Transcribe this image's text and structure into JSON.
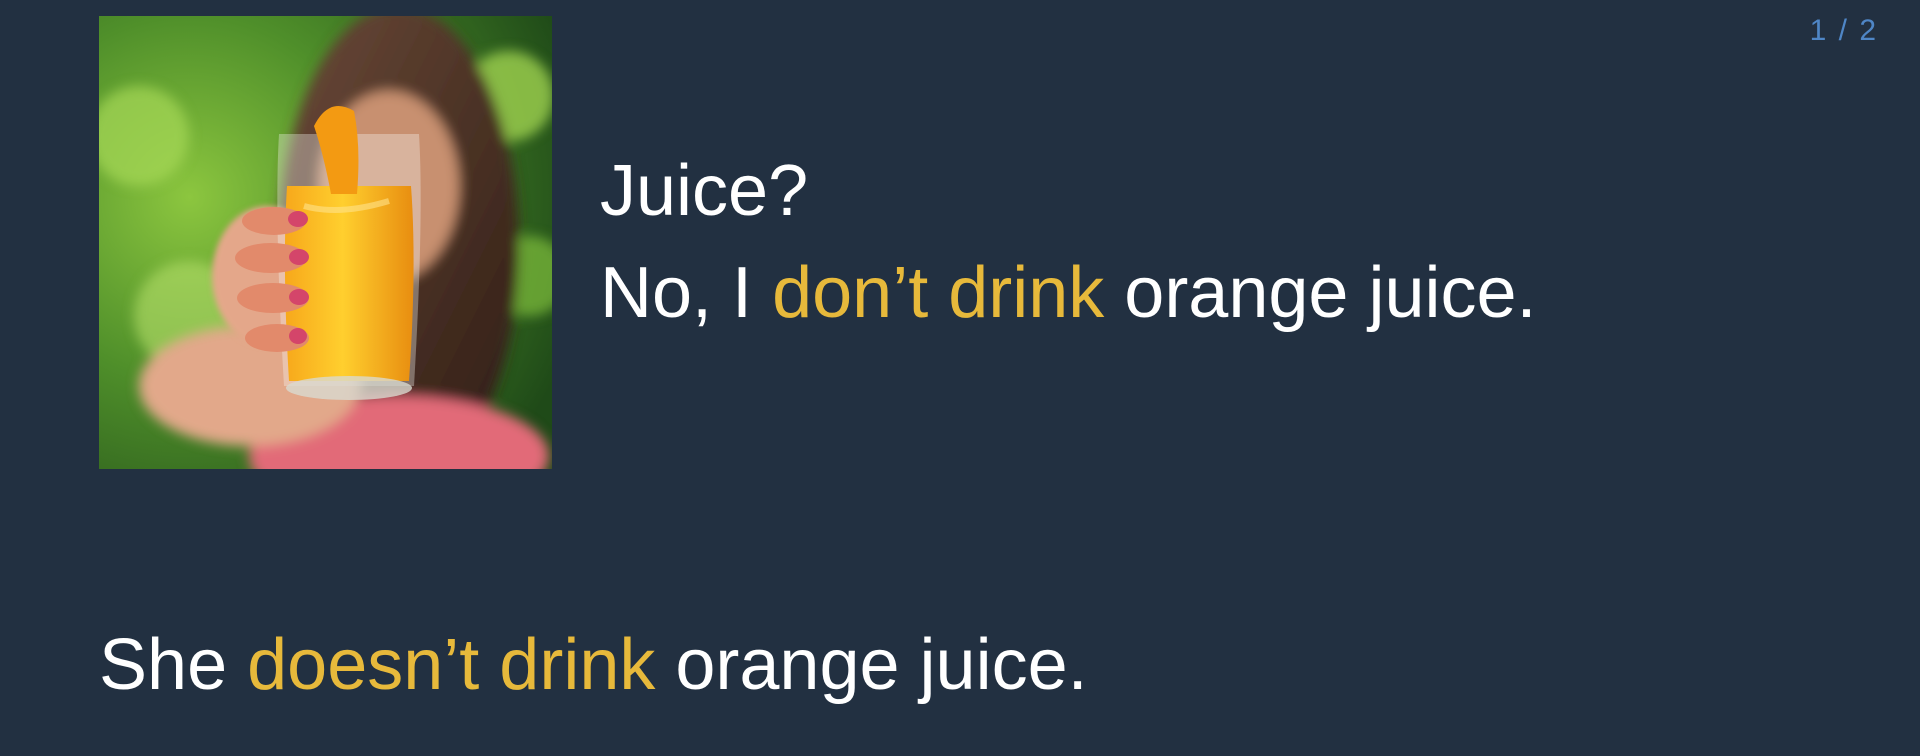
{
  "counter": "1 / 2",
  "photo": {
    "alt": "Woman holding a glass of orange juice toward the camera"
  },
  "dialog": {
    "question": "Juice?",
    "answer_start": "No, I ",
    "answer_highlight": "don’t drink",
    "answer_end": " orange juice."
  },
  "summary": {
    "start": "She ",
    "highlight": "doesn’t drink",
    "end": " orange juice."
  },
  "colors": {
    "background": "#223041",
    "text": "#ffffff",
    "highlight": "#e7b93b",
    "counter": "#4f86c6"
  }
}
